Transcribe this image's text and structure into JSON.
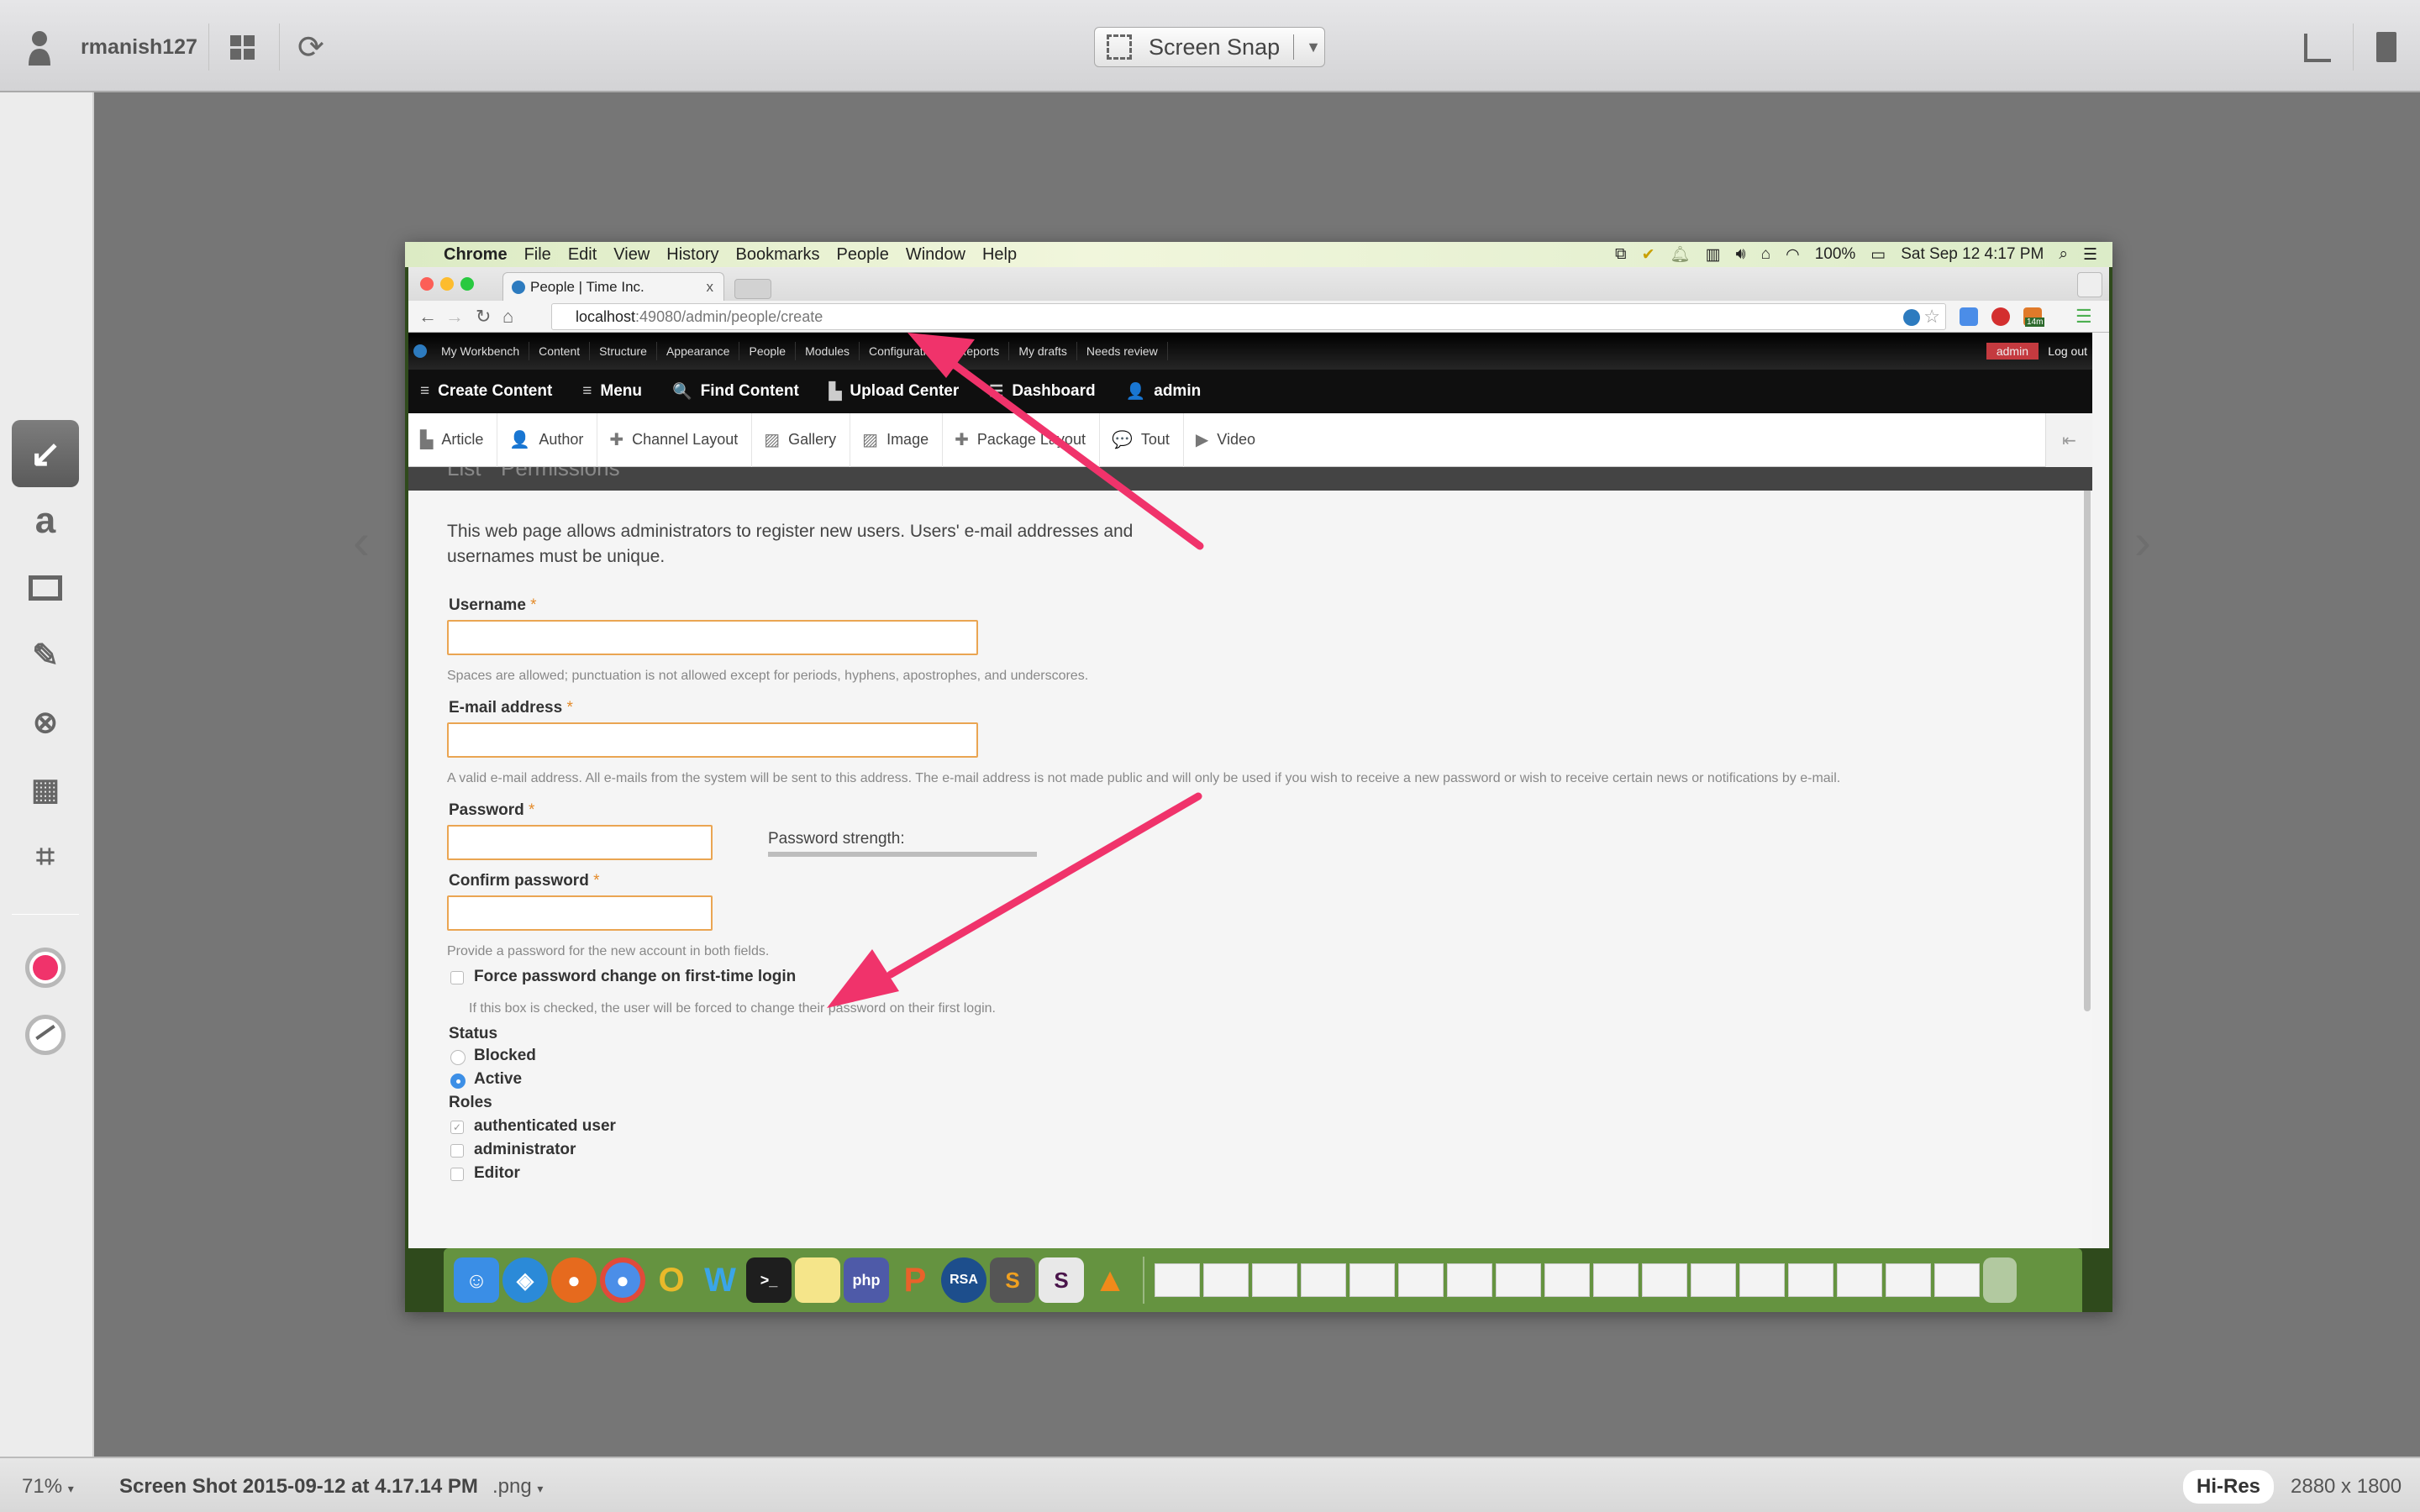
{
  "app_toolbar": {
    "user": "rmanish127",
    "snap_button": "Screen Snap",
    "icons": [
      "user-icon",
      "grid-icon",
      "sync-icon",
      "share-icon",
      "trash-icon"
    ]
  },
  "tool_rail": {
    "tools": [
      "arrow",
      "text",
      "rectangle",
      "highlighter",
      "blur",
      "pixelate",
      "crop"
    ],
    "active_tool": "arrow",
    "text_tool_glyph": "a",
    "color": "#f0336b"
  },
  "mac_menu": {
    "app": "Chrome",
    "items": [
      "File",
      "Edit",
      "View",
      "History",
      "Bookmarks",
      "People",
      "Window",
      "Help"
    ],
    "battery": "100%",
    "clock": "Sat Sep 12  4:17 PM"
  },
  "browser": {
    "tab_title": "People | Time Inc.",
    "tab_close": "x",
    "url_host": "localhost",
    "url_path": ":49080/admin/people/create",
    "extension_badge": "14m"
  },
  "drupal": {
    "admin_menu": [
      "My Workbench",
      "Content",
      "Structure",
      "Appearance",
      "People",
      "Modules",
      "Configuration",
      "Reports",
      "My drafts",
      "Needs review"
    ],
    "user_badge": "admin",
    "logout": "Log out",
    "shortcuts": [
      {
        "label": "Create Content",
        "icon": "≡"
      },
      {
        "label": "Menu",
        "icon": "≡"
      },
      {
        "label": "Find Content",
        "icon": "🔍"
      },
      {
        "label": "Upload Center",
        "icon": "▙"
      },
      {
        "label": "Dashboard",
        "icon": "☰"
      },
      {
        "label": "admin",
        "icon": "👤"
      }
    ],
    "content_types": [
      {
        "label": "Article",
        "icon": "▙"
      },
      {
        "label": "Author",
        "icon": "👤"
      },
      {
        "label": "Channel Layout",
        "icon": "✚"
      },
      {
        "label": "Gallery",
        "icon": "▨"
      },
      {
        "label": "Image",
        "icon": "▨"
      },
      {
        "label": "Package Layout",
        "icon": "✚"
      },
      {
        "label": "Tout",
        "icon": "💬"
      },
      {
        "label": "Video",
        "icon": "▶"
      }
    ],
    "tabs": [
      "List",
      "Permissions"
    ]
  },
  "form": {
    "intro": "This web page allows administrators to register new users. Users' e-mail addresses and usernames must be unique.",
    "required_mark": "*",
    "username": {
      "label": "Username",
      "value": "",
      "help": "Spaces are allowed; punctuation is not allowed except for periods, hyphens, apostrophes, and underscores."
    },
    "email": {
      "label": "E-mail address",
      "value": "",
      "help": "A valid e-mail address. All e-mails from the system will be sent to this address. The e-mail address is not made public and will only be used if you wish to receive a new password or wish to receive certain news or notifications by e-mail."
    },
    "password": {
      "label": "Password",
      "value": "",
      "strength_label": "Password strength:"
    },
    "confirm_password": {
      "label": "Confirm password",
      "value": "",
      "help": "Provide a password for the new account in both fields."
    },
    "force_change": {
      "label": "Force password change on first-time login",
      "checked": false,
      "help": "If this box is checked, the user will be forced to change their password on their first login."
    },
    "status": {
      "label": "Status",
      "options": [
        "Blocked",
        "Active"
      ],
      "selected": "Active"
    },
    "roles": {
      "label": "Roles",
      "options": [
        {
          "label": "authenticated user",
          "checked": true
        },
        {
          "label": "administrator",
          "checked": false
        },
        {
          "label": "Editor",
          "checked": false
        }
      ]
    }
  },
  "dock": {
    "apps": [
      "Finder",
      "Safari",
      "Firefox",
      "Chrome",
      "Outlook",
      "Word",
      "Terminal",
      "Notes",
      "PhpStorm",
      "Pages",
      "RSA SecurID",
      "Sublime Text",
      "Slack",
      "VLC"
    ],
    "trash": "Trash"
  },
  "bottom_bar": {
    "zoom": "71%",
    "filename": "Screen Shot 2015-09-12 at 4.17.14 PM",
    "extension": ".png",
    "hires": "Hi-Res",
    "dimensions": "2880 x 1800"
  }
}
